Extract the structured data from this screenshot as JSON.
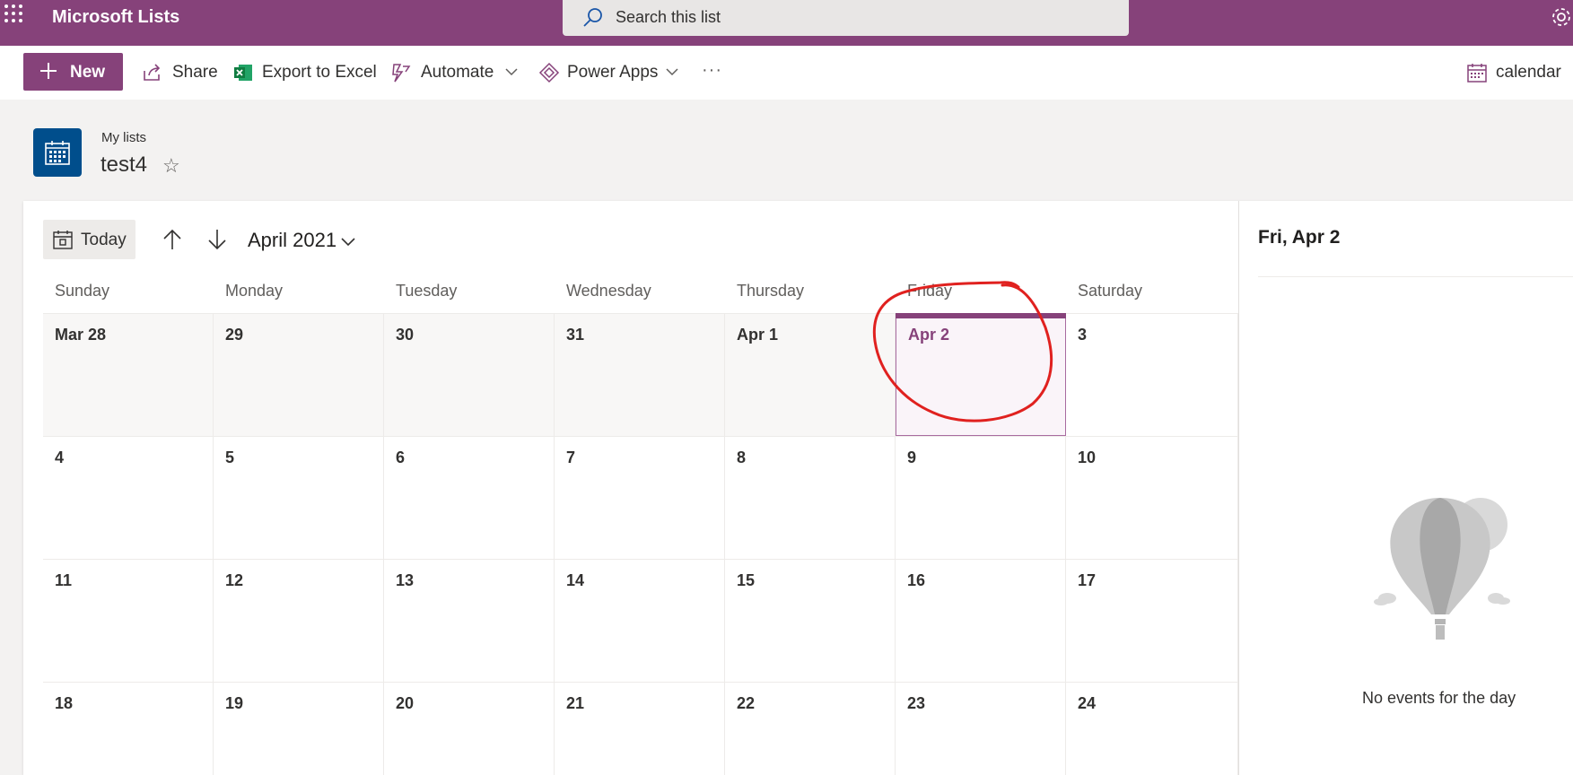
{
  "app": {
    "title": "Microsoft Lists",
    "search_placeholder": "Search this list"
  },
  "toolbar": {
    "new_label": "New",
    "share_label": "Share",
    "export_label": "Export to Excel",
    "automate_label": "Automate",
    "powerapps_label": "Power Apps",
    "more_label": "···",
    "view_label": "calendar"
  },
  "header": {
    "breadcrumb": "My lists",
    "list_name": "test4",
    "favorite_icon": "☆"
  },
  "calendar": {
    "today_label": "Today",
    "month_label": "April 2021",
    "weekdays": [
      "Sunday",
      "Monday",
      "Tuesday",
      "Wednesday",
      "Thursday",
      "Friday",
      "Saturday"
    ],
    "weeks": [
      [
        "Mar 28",
        "29",
        "30",
        "31",
        "Apr 1",
        "Apr 2",
        "3"
      ],
      [
        "4",
        "5",
        "6",
        "7",
        "8",
        "9",
        "10"
      ],
      [
        "11",
        "12",
        "13",
        "14",
        "15",
        "16",
        "17"
      ],
      [
        "18",
        "19",
        "20",
        "21",
        "22",
        "23",
        "24"
      ]
    ],
    "selected_day": "Apr 2"
  },
  "panel": {
    "date": "Fri, Apr 2",
    "empty_message": "No events for the day"
  },
  "colors": {
    "brand": "#86427a",
    "list_icon": "#004e8c",
    "annotation": "#e0211f"
  },
  "icons": [
    "waffle-icon",
    "search-icon",
    "settings-gear-icon",
    "plus-icon",
    "share-icon",
    "excel-icon",
    "automate-icon",
    "power-apps-icon",
    "calendar-view-icon",
    "chevron-down-icon",
    "calendar-today-icon",
    "arrow-up-icon",
    "arrow-down-icon",
    "list-calendar-icon",
    "star-icon",
    "balloon-illustration"
  ]
}
